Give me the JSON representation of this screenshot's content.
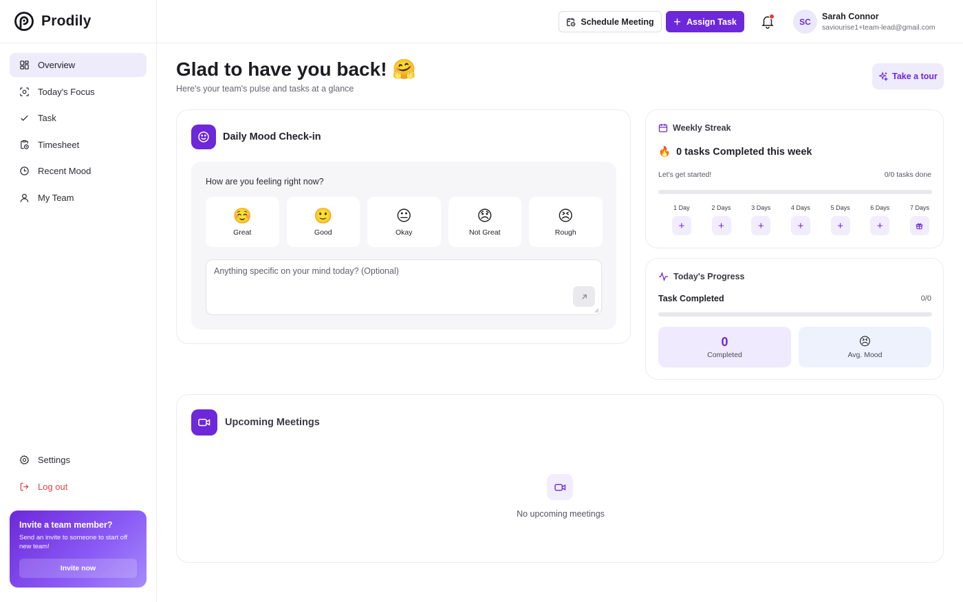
{
  "brand": {
    "name": "Prodily",
    "accent": "#6d28d9"
  },
  "sidebar": {
    "items": [
      {
        "label": "Overview",
        "icon": "grid-icon",
        "active": true
      },
      {
        "label": "Today's Focus",
        "icon": "focus-icon"
      },
      {
        "label": "Task",
        "icon": "check-icon"
      },
      {
        "label": "Timesheet",
        "icon": "timesheet-icon"
      },
      {
        "label": "Recent Mood",
        "icon": "clock-icon"
      },
      {
        "label": "My Team",
        "icon": "user-icon"
      }
    ],
    "bottom": [
      {
        "label": "Settings",
        "icon": "gear-icon"
      },
      {
        "label": "Log out",
        "icon": "logout-icon"
      }
    ],
    "invite": {
      "title": "Invite a team member?",
      "text": "Send an invite to someone to start off new team!",
      "button": "Invite now"
    }
  },
  "header": {
    "schedule_label": "Schedule Meeting",
    "assign_label": "Assign Task",
    "user": {
      "initials": "SC",
      "name": "Sarah Connor",
      "email": "saviourise1+team-lead@gmail.com"
    }
  },
  "main": {
    "greeting": "Glad to have you back! 🤗",
    "subtitle": "Here's your team's pulse and tasks at a glance",
    "tour_label": "Take a tour"
  },
  "mood": {
    "title": "Daily Mood Check-in",
    "question": "How are you feeling right now?",
    "options": [
      {
        "emoji": "☺️",
        "label": "Great"
      },
      {
        "emoji": "🙂",
        "label": "Good"
      },
      {
        "emoji": "😐",
        "label": "Okay"
      },
      {
        "emoji": "😞",
        "label": "Not Great"
      },
      {
        "emoji": "😣",
        "label": "Rough"
      }
    ],
    "note_placeholder": "Anything specific on your mind today? (Optional)",
    "note_value": ""
  },
  "streak": {
    "title": "Weekly Streak",
    "headline": "0 tasks Completed this week",
    "fire": "🔥",
    "subtitle": "Let's get started!",
    "done": "0/0 tasks done",
    "progress": 0,
    "days": [
      "1 Day",
      "2 Days",
      "3 Days",
      "4 Days",
      "5 Days",
      "6 Days",
      "7 Days"
    ]
  },
  "progress": {
    "title": "Today's Progress",
    "task_label": "Task Completed",
    "task_count": "0/0",
    "fraction": 0,
    "completed_value": "0",
    "completed_label": "Completed",
    "avg_mood_emoji": "😣",
    "avg_mood_label": "Avg. Mood"
  },
  "meetings": {
    "title": "Upcoming Meetings",
    "empty": "No upcoming meetings"
  }
}
